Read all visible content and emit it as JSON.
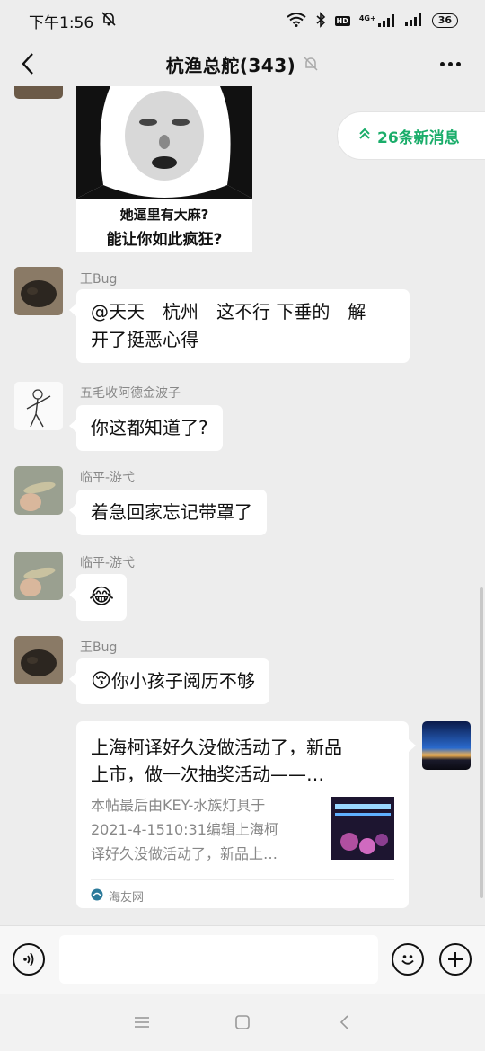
{
  "status_bar": {
    "time": "下午1:56",
    "network": "4G+",
    "battery": "36"
  },
  "header": {
    "title": "杭渔总舵(343)"
  },
  "new_messages": {
    "label": "26条新消息"
  },
  "sticker": {
    "caption_line1": "她逼里有大麻?",
    "caption_line2": "能让你如此疯狂?"
  },
  "messages": [
    {
      "sender": "王Bug",
      "lines": [
        "@天天　杭州　这不行 下垂的　解",
        "开了挺恶心得"
      ]
    },
    {
      "sender": "五毛收阿德金波子",
      "text": "你这都知道了?"
    },
    {
      "sender": "临平-游弋",
      "text": "着急回家忘记带罩了"
    },
    {
      "sender": "临平-游弋",
      "emoji": "😂"
    },
    {
      "sender": "王Bug",
      "emoji": "😚",
      "text": "你小孩子阅历不够"
    }
  ],
  "link_card": {
    "title_lines": [
      "上海柯译好久没做活动了，新品",
      "上市，做一次抽奖活动——…"
    ],
    "desc_lines": [
      "本帖最后由KEY-水族灯具于",
      "2021-4-1510:31编辑上海柯",
      "译好久没做活动了，新品上…"
    ],
    "source": "海友网"
  },
  "colors": {
    "accent_green": "#1aad6a",
    "background": "#ededed",
    "bubble": "#ffffff"
  }
}
